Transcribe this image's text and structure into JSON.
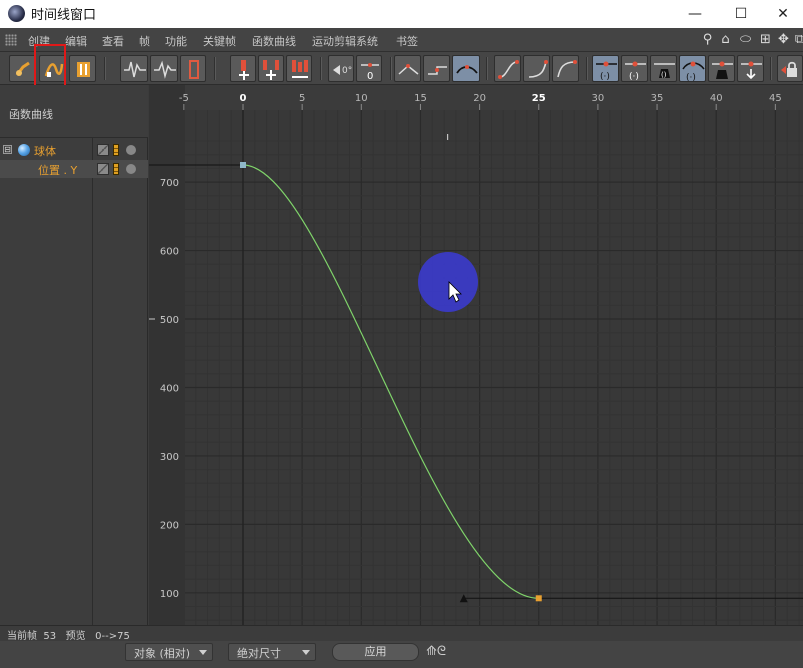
{
  "window": {
    "title": "时间线窗口",
    "minimize_glyph": "—",
    "maximize_glyph": "☐",
    "close_glyph": "✕",
    "icon": "cinema4d-logo-icon"
  },
  "menubar": {
    "items": [
      "创建",
      "编辑",
      "查看",
      "帧",
      "功能",
      "关键帧",
      "函数曲线",
      "运动剪辑系统",
      "书签"
    ],
    "right_icons": [
      "search-icon",
      "home-icon",
      "shape-icon",
      "frame-icon",
      "move-icon",
      "layout-icon"
    ],
    "right_glyphs": [
      "⚲",
      "⌂",
      "⬭",
      "⊞",
      "✥",
      "⧉"
    ]
  },
  "toolbar": {
    "groups": [
      {
        "name": "mode",
        "buttons": [
          "key-mode-icon",
          "function-curve-mode-icon",
          "motion-clip-mode-icon"
        ]
      },
      {
        "name": "view",
        "buttons": [
          "show-curve-icon",
          "show-tangent-icon",
          "track-icon"
        ]
      },
      {
        "name": "keys",
        "buttons": [
          "add-key-icon",
          "add-keys-icon",
          "record-icon",
          "delete-key-icon"
        ]
      },
      {
        "name": "zero",
        "buttons": [
          "zero-angle-icon",
          "zero-length-icon"
        ]
      },
      {
        "name": "interpolation",
        "buttons": [
          "linear-icon",
          "step-icon",
          "spline-icon"
        ]
      },
      {
        "name": "ease",
        "buttons": [
          "ease-in-out-icon",
          "ease-in-icon",
          "ease-out-icon"
        ]
      },
      {
        "name": "tangent",
        "buttons": [
          "lock-tangent-icon",
          "break-tangent-icon",
          "lock-weight-icon",
          "auto-tangent-icon",
          "clamp-icon",
          "remove-overshoot-icon"
        ]
      },
      {
        "name": "extra",
        "buttons": [
          "lock-key-icon"
        ]
      }
    ]
  },
  "left_panel": {
    "title": "函数曲线",
    "tree": [
      {
        "toggle": "⊟",
        "label": "球体",
        "type": "object"
      },
      {
        "label": "位置 . Y",
        "type": "track"
      }
    ]
  },
  "graph": {
    "x_axis_ticks": [
      "-5",
      "0",
      "5",
      "10",
      "15",
      "20",
      "25",
      "30",
      "35",
      "40",
      "45"
    ],
    "y_axis_ticks": [
      "700",
      "600",
      "500",
      "400",
      "300",
      "200",
      "100"
    ],
    "curve": {
      "property": "位置 . Y",
      "color": "#7fd36a",
      "keyframes": [
        {
          "frame": 0,
          "value": 725
        },
        {
          "frame": 25,
          "value": 92
        }
      ],
      "interpolation": "ease-in-out"
    },
    "cursor_highlight_color": "#3b3bd6",
    "key_colors": {
      "first": "#8fb8c9",
      "last": "#e8a030"
    }
  },
  "status": {
    "text": "当前帧  53   预览   0-->75"
  },
  "bottom": {
    "dropdown1": "对象 (相对)",
    "dropdown2": "绝对尺寸",
    "apply": "应用",
    "icon": "snap-icon",
    "icon_glyph": "⟰ᘓ"
  }
}
